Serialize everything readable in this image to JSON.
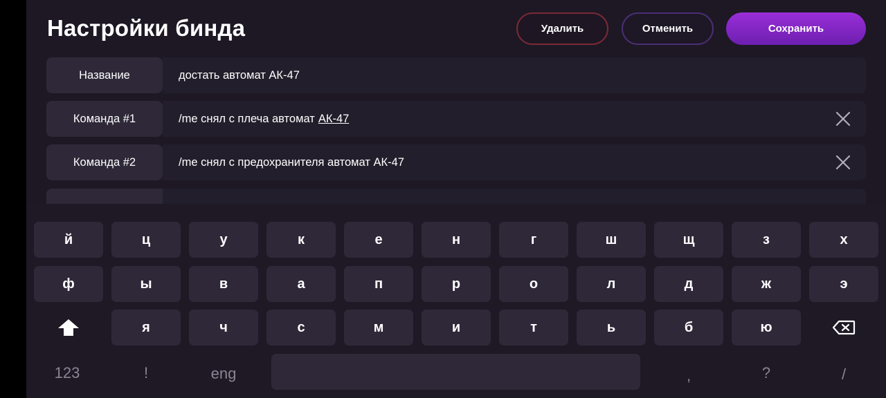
{
  "header": {
    "title": "Настройки бинда",
    "delete_label": "Удалить",
    "cancel_label": "Отменить",
    "save_label": "Сохранить"
  },
  "fields": {
    "name": {
      "label": "Название",
      "value": "достать автомат АК-47"
    },
    "command1": {
      "label": "Команда #1",
      "value_prefix": "/me снял с плеча автомат",
      "value_underlined": "АК-47"
    },
    "command2": {
      "label": "Команда #2",
      "value": "/me снял с предохранителя автомат АК-47"
    }
  },
  "keyboard": {
    "row1": [
      "й",
      "ц",
      "у",
      "к",
      "е",
      "н",
      "г",
      "ш",
      "щ",
      "з",
      "х"
    ],
    "row2": [
      "ф",
      "ы",
      "в",
      "а",
      "п",
      "р",
      "о",
      "л",
      "д",
      "ж",
      "э"
    ],
    "row3": [
      "я",
      "ч",
      "с",
      "м",
      "и",
      "т",
      "ь",
      "б",
      "ю"
    ],
    "row4": {
      "numbers": "123",
      "exclam": "!",
      "lang": "eng",
      "comma": ",",
      "question": "?",
      "slash": "/"
    },
    "icons": {
      "shift": "shift-icon",
      "backspace": "backspace-icon"
    }
  },
  "colors": {
    "accent": "#8a27cc",
    "delete_border": "#7a2a36",
    "cancel_border": "#4a2f74",
    "background": "#1d1824"
  }
}
